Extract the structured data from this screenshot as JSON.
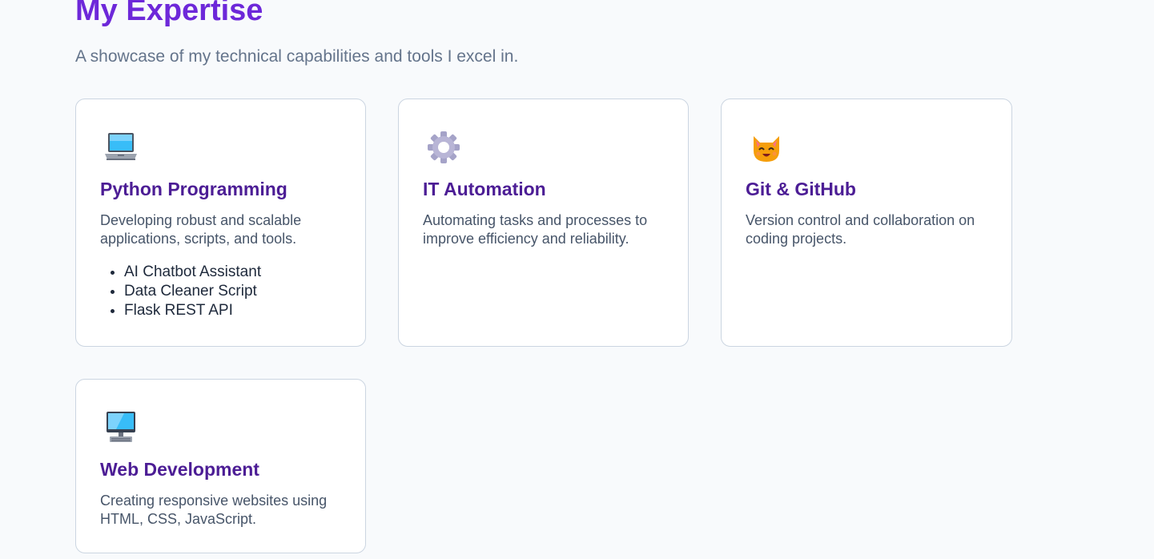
{
  "header": {
    "title": "My Expertise",
    "subtitle": "A showcase of my technical capabilities and tools I excel in."
  },
  "cards": [
    {
      "icon": "laptop-icon",
      "title": "Python Programming",
      "description": "Developing robust and scalable applications, scripts, and tools.",
      "projects": [
        "AI Chatbot Assistant",
        "Data Cleaner Script",
        "Flask REST API"
      ]
    },
    {
      "icon": "gear-icon",
      "title": "IT Automation",
      "description": "Automating tasks and processes to improve efficiency and reliability."
    },
    {
      "icon": "cat-icon",
      "title": "Git & GitHub",
      "description": "Version control and collaboration on coding projects."
    },
    {
      "icon": "desktop-computer-icon",
      "title": "Web Development",
      "description": "Creating responsive websites using HTML, CSS, JavaScript."
    }
  ],
  "colors": {
    "accent": "#6d28d9",
    "card_title": "#4c1d95",
    "text_muted": "#64748b",
    "background": "#f8fafc"
  }
}
